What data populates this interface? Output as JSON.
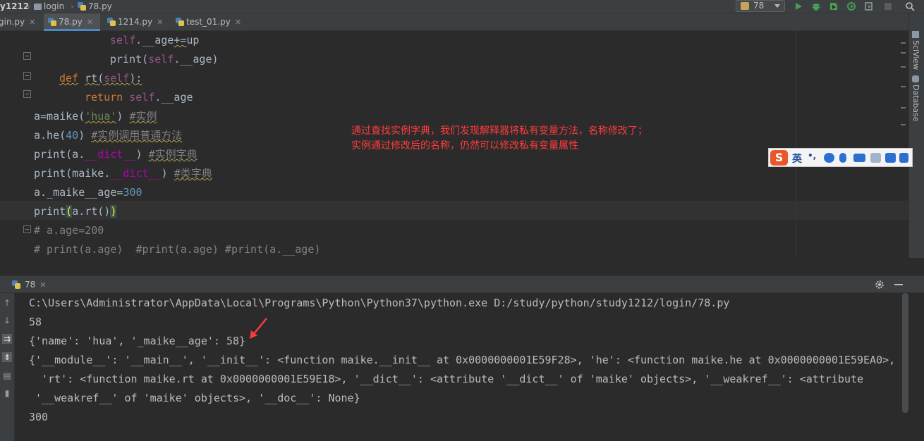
{
  "breadcrumb": {
    "project": "y1212",
    "folder": "login",
    "file": "78.py"
  },
  "run_config": {
    "label": "78"
  },
  "tabs": [
    {
      "label": "gin.py"
    },
    {
      "label": "78.py"
    },
    {
      "label": "1214.py"
    },
    {
      "label": "test_01.py"
    }
  ],
  "right_strip": {
    "sciview": "SciView",
    "database": "Database"
  },
  "annotation": {
    "line1": "通过查找实例字典，我们发现解释器将私有变量方法，名称修改了；",
    "line2": "实例通过修改后的名称，仍然可以修改私有变量属性"
  },
  "ime": {
    "mode": "英",
    "punct": "•,"
  },
  "run_panel": {
    "tab_label": "78"
  },
  "console": {
    "lines": [
      "C:\\Users\\Administrator\\AppData\\Local\\Programs\\Python\\Python37\\python.exe D:/study/python/study1212/login/78.py",
      "58",
      "{'name': 'hua', '_maike__age': 58}",
      "{'__module__': '__main__', '__init__': <function maike.__init__ at 0x0000000001E59F28>, 'he': <function maike.he at 0x0000000001E59EA0>,",
      "  'rt': <function maike.rt at 0x0000000001E59E18>, '__dict__': <attribute '__dict__' of 'maike' objects>, '__weakref__': <attribute",
      " '__weakref__' of 'maike' objects>, '__doc__': None}",
      "300"
    ]
  },
  "code": {
    "l1": [
      "self",
      ".",
      "__age",
      "+=",
      "up"
    ],
    "l2": [
      "print",
      "(",
      "self",
      ".",
      "__age",
      ")"
    ],
    "l3": [
      "def",
      "rt",
      "(",
      "self",
      "):"
    ],
    "l4": [
      "return",
      "self",
      ".",
      "__age"
    ],
    "l5": [
      "a",
      "=maike(",
      "'hua'",
      ") ",
      "#实例"
    ],
    "l6": [
      "a.he(",
      "40",
      ") ",
      "#实例调用普通方法"
    ],
    "l7": [
      "print",
      "(a.",
      "__dict__",
      ") ",
      "#实例字典"
    ],
    "l8": [
      "print",
      "(maike.",
      "__dict__",
      ") ",
      "#类字典"
    ],
    "l9": [
      "a._maike__age=",
      "300"
    ],
    "l10": [
      "print",
      "(",
      "a.rt()",
      ")"
    ],
    "l11": [
      "# a.age=200"
    ],
    "l12": [
      "# print(a.age)  #print(a.age) #print(a.__age)"
    ]
  },
  "colors": {
    "keyword": "#cc7832",
    "self": "#94558d",
    "number": "#6897bb",
    "string": "#6a8759",
    "comment": "#808080",
    "annotation": "#ff3b3b",
    "active_tab_underline": "#4a88c7"
  }
}
